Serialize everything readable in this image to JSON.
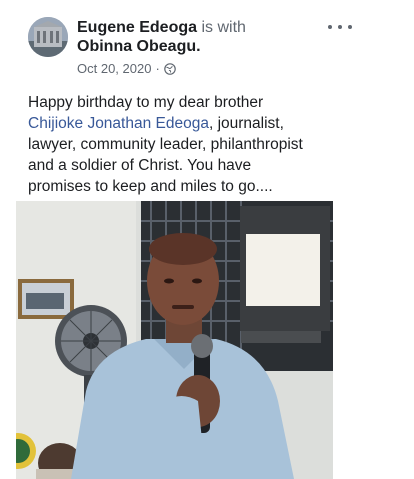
{
  "post": {
    "author": "Eugene Edeoga",
    "with_text": "is with",
    "tagged": "Obinna Obeagu",
    "tagged_suffix": ".",
    "date": "Oct 20, 2020",
    "separator": "·",
    "privacy_icon": "globe-icon",
    "more_icon": "more-options-icon",
    "text_lines": {
      "l1": "Happy birthday to my dear brother",
      "l2_mention": "Chijioke Jonathan Edeoga",
      "l2_rest": ", journalist,",
      "l3": "lawyer, community leader, philanthropist",
      "l4": "and a soldier of Christ. You have",
      "l5": "promises to keep and miles to go...."
    },
    "photo_icon": "post-photo"
  },
  "colors": {
    "text": "#1c1e21",
    "muted": "#606770",
    "link": "#385898",
    "background": "#ffffff"
  }
}
